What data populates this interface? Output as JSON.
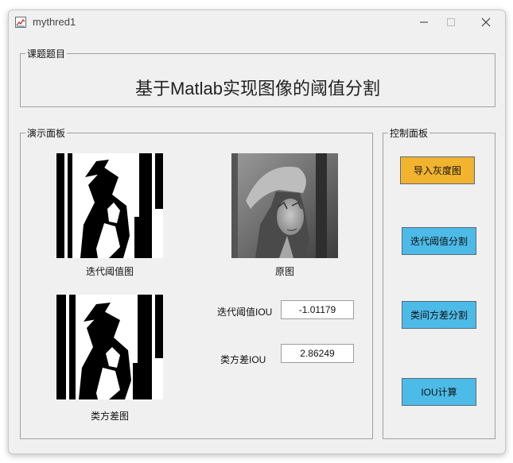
{
  "window": {
    "title": "mythred1"
  },
  "topic_panel": {
    "legend": "课题题目",
    "headline": "基于Matlab实现图像的阈值分割"
  },
  "demo_panel": {
    "legend": "演示面板",
    "images": [
      {
        "caption": "迭代阈值图",
        "style": "binary"
      },
      {
        "caption": "原图",
        "style": "grayscale"
      },
      {
        "caption": "类方差图",
        "style": "binary"
      }
    ],
    "iou_iterative": {
      "label": "迭代阈值IOU",
      "value": "-1.01179"
    },
    "iou_variance": {
      "label": "类方差IOU",
      "value": "2.86249"
    }
  },
  "control_panel": {
    "legend": "控制面板",
    "buttons": [
      {
        "label": "导入灰度图",
        "color": "#f2b32e"
      },
      {
        "label": "迭代阈值分割",
        "color": "#4dbbe8"
      },
      {
        "label": "类间方差分割",
        "color": "#4dbbe8"
      },
      {
        "label": "IOU计算",
        "color": "#4dbbe8"
      }
    ]
  }
}
